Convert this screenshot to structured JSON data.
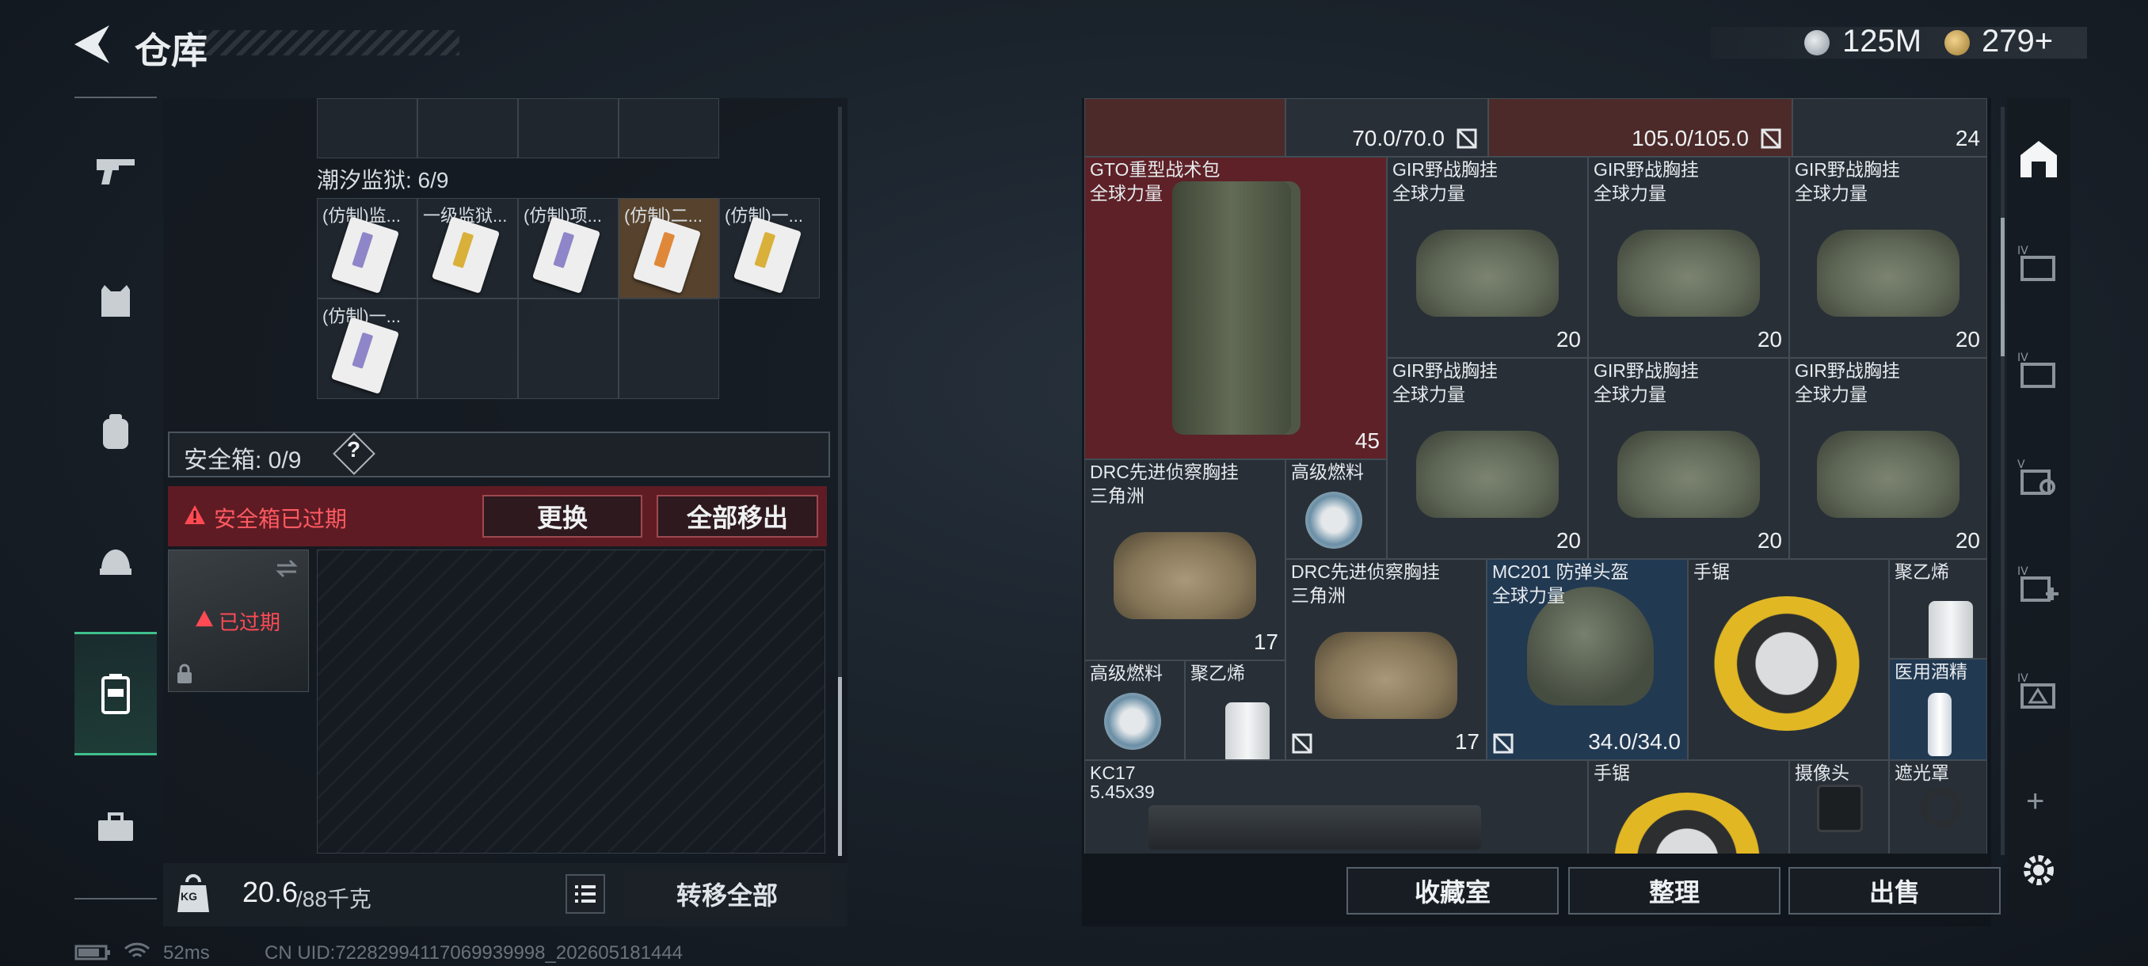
{
  "header": {
    "title": "仓库",
    "silver_amount": "125M",
    "gold_amount": "279+"
  },
  "nav": {
    "items": [
      {
        "icon": "gun-icon"
      },
      {
        "icon": "vest-icon"
      },
      {
        "icon": "backpack-icon"
      },
      {
        "icon": "helmet-icon"
      },
      {
        "icon": "safe-case-icon",
        "active": true
      },
      {
        "icon": "toolbox-icon"
      }
    ]
  },
  "left": {
    "section_title": "潮汐监狱: 6/9",
    "cards": [
      {
        "label": "(仿制)监...",
        "color": "purple"
      },
      {
        "label": "一级监狱...",
        "color": "yellow"
      },
      {
        "label": "(仿制)项...",
        "color": "purple"
      },
      {
        "label": "(仿制)二...",
        "color": "orange"
      },
      {
        "label": "(仿制)一...",
        "color": "yellow"
      },
      {
        "label": "(仿制)一...",
        "color": "purple"
      }
    ],
    "safebox_label": "安全箱: 0/9",
    "safebox_help": "?",
    "warning_text": "安全箱已过期",
    "replace_button": "更换",
    "remove_all_button": "全部移出",
    "expired_text": "已过期",
    "weight_value": "20.6",
    "weight_total": "/88千克",
    "kg_icon_text": "KG",
    "transfer_all_button": "转移全部"
  },
  "right": {
    "top_row": {
      "durability_a": "70.0/70.0",
      "durability_b": "105.0/105.0",
      "count_top": "24"
    },
    "items": {
      "gto_name": "GTO重型战术包",
      "gto_sub": "全球力量",
      "gto_count": "45",
      "gir_name": "GIR野战胸挂",
      "gir_sub": "全球力量",
      "gir_count": "20",
      "drc_name": "DRC先进侦察胸挂",
      "drc_sub": "三角洲",
      "drc_count": "17",
      "fuel_name": "高级燃料",
      "poly_name": "聚乙烯",
      "helmet_name": "MC201 防弹头盔",
      "helmet_sub": "全球力量",
      "helmet_dur": "34.0/34.0",
      "saw_name": "手锯",
      "alcohol_name": "医用酒精",
      "kc_name": "KC17",
      "kc_sub": "5.45x39",
      "camera_name": "摄像头",
      "shade_name": "遮光罩"
    },
    "buttons": {
      "collection": "收藏室",
      "organize": "整理",
      "sell": "出售"
    }
  },
  "side_icons": [
    "home-icon",
    "folder-iv-a-icon",
    "folder-iv-b-icon",
    "search-v-icon",
    "add-iv-icon",
    "shield-iv-icon",
    "plus-icon",
    "settings-icon"
  ],
  "side_labels": {
    "plus": "+"
  },
  "footer": {
    "ping": "52ms",
    "uid": "CN UID:72282994117069939998_202605181444"
  }
}
